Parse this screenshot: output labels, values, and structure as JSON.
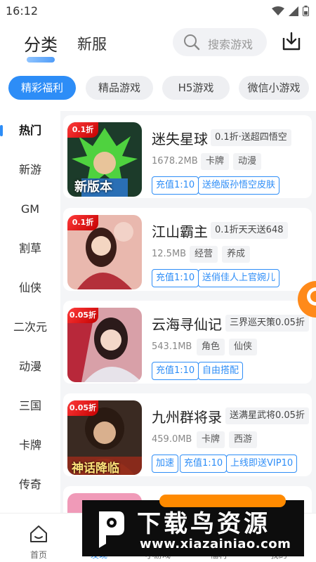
{
  "status_bar": {
    "time": "16:12",
    "icons": [
      "wifi-icon",
      "signal-icon",
      "battery-icon"
    ]
  },
  "header": {
    "tabs": [
      {
        "label": "分类"
      },
      {
        "label": "新服"
      }
    ],
    "active_tab": 0,
    "search": {
      "placeholder": "搜索游戏",
      "icon": "search-icon"
    },
    "download_icon": "download-icon"
  },
  "categories": [
    {
      "label": "精彩福利",
      "active": true
    },
    {
      "label": "精品游戏",
      "active": false
    },
    {
      "label": "H5游戏",
      "active": false
    },
    {
      "label": "微信小游戏",
      "active": false
    }
  ],
  "sidebar": {
    "items": [
      {
        "label": "热门",
        "active": true
      },
      {
        "label": "新游"
      },
      {
        "label": "GM"
      },
      {
        "label": "割草"
      },
      {
        "label": "仙侠"
      },
      {
        "label": "二次元"
      },
      {
        "label": "动漫"
      },
      {
        "label": "三国"
      },
      {
        "label": "卡牌"
      },
      {
        "label": "传奇"
      }
    ]
  },
  "games": [
    {
      "title": "迷失星球",
      "promo": "0.1折·送超四悟空",
      "size": "1678.2MB",
      "tags": [
        "卡牌",
        "动漫"
      ],
      "welfare": [
        "充值1:10",
        "送绝版孙悟空皮肤"
      ],
      "badge": "0.1折",
      "art_text": "新版本",
      "accent": "#1f8f2f"
    },
    {
      "title": "江山霸主",
      "promo": "0.1折天天送648",
      "size": "12.5MB",
      "tags": [
        "经营",
        "养成"
      ],
      "welfare": [
        "充值1:10",
        "送俏佳人上官婉儿"
      ],
      "badge": "0.1折",
      "art_text": "",
      "accent": "#c94a4a"
    },
    {
      "title": "云海寻仙记",
      "promo": "三界巡天策0.05折",
      "size": "543.1MB",
      "tags": [
        "角色",
        "仙侠"
      ],
      "welfare": [
        "充值1:10",
        "自由搭配"
      ],
      "badge": "0.05折",
      "art_text": "",
      "accent": "#c23b4e"
    },
    {
      "title": "九州群将录",
      "promo": "送满星武将0.05折",
      "size": "459.0MB",
      "tags": [
        "卡牌",
        "西游"
      ],
      "welfare": [
        "加速",
        "充值1:10",
        "上线即送VIP10"
      ],
      "badge": "0.05折",
      "art_text": "神话降临",
      "accent": "#8a4a22"
    }
  ],
  "bottom_nav": {
    "items": [
      {
        "label": "首页",
        "icon": "home-icon"
      },
      {
        "label": "发现",
        "icon": "discover-icon",
        "active": true
      },
      {
        "label": "小游戏",
        "icon": "minigame-icon"
      },
      {
        "label": "福利",
        "icon": "welfare-icon"
      },
      {
        "label": "我的",
        "icon": "profile-icon"
      }
    ]
  },
  "watermark": {
    "name": "下载鸟资源",
    "url": "www.xiazainiao.com"
  }
}
